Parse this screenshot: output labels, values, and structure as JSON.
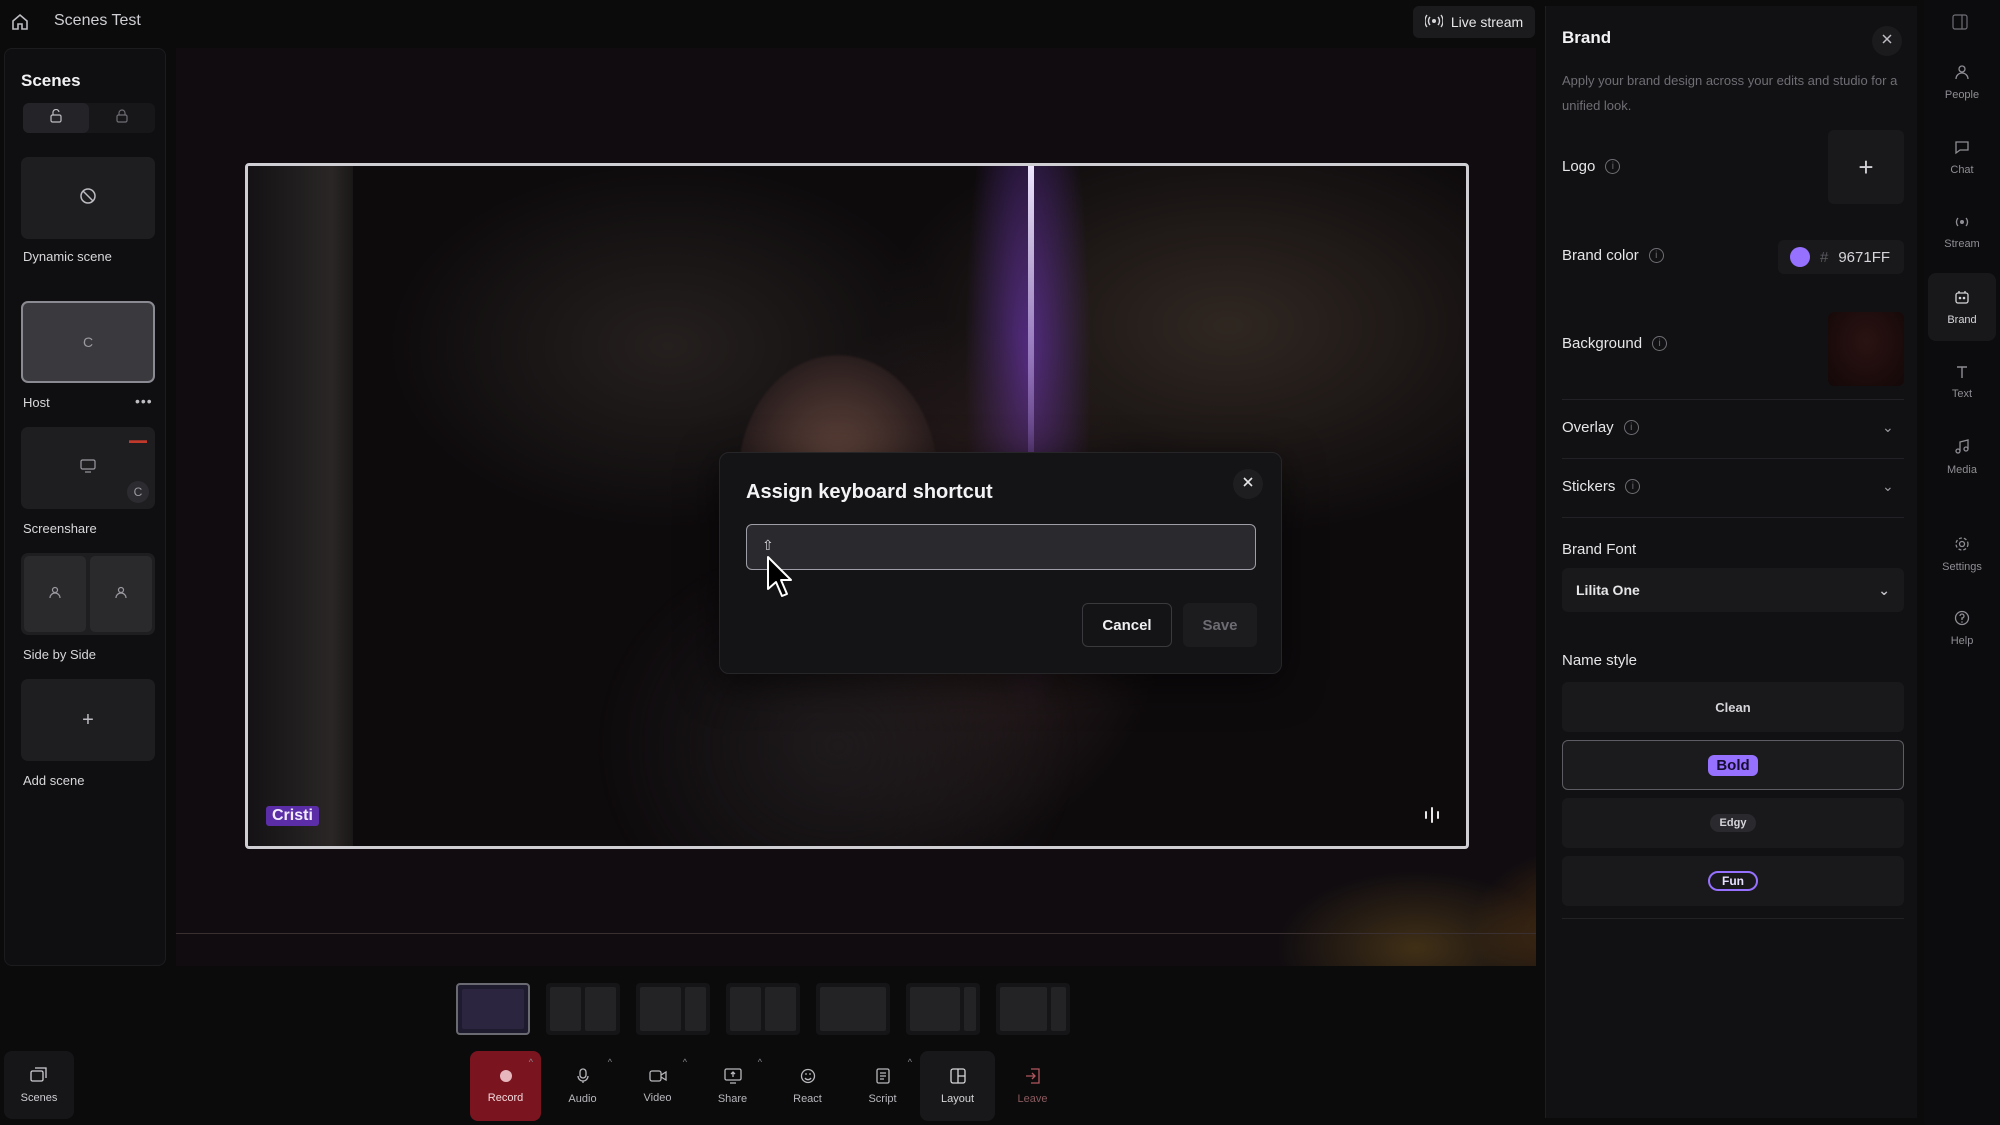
{
  "app": {
    "title": "Scenes Test",
    "live_stream_label": "Live stream"
  },
  "scenes": {
    "title": "Scenes",
    "items": [
      {
        "label": "Dynamic scene"
      },
      {
        "label": "Host",
        "thumb_text": "C"
      },
      {
        "label": "Screenshare",
        "badge": "C"
      },
      {
        "label": "Side by Side"
      },
      {
        "label": "Add scene"
      }
    ]
  },
  "stage": {
    "name_tag": "Cristi"
  },
  "modal": {
    "title": "Assign keyboard shortcut",
    "input_value": "",
    "shift_glyph": "⇧",
    "cancel_label": "Cancel",
    "save_label": "Save"
  },
  "toolbar": {
    "scenes_label": "Scenes",
    "items": [
      {
        "label": "Record"
      },
      {
        "label": "Audio"
      },
      {
        "label": "Video"
      },
      {
        "label": "Share"
      },
      {
        "label": "React"
      },
      {
        "label": "Script"
      },
      {
        "label": "Layout"
      },
      {
        "label": "Leave"
      }
    ]
  },
  "brand": {
    "title": "Brand",
    "description": "Apply your brand design across your edits and studio for a unified look.",
    "logo_label": "Logo",
    "brand_color_label": "Brand color",
    "brand_color_hex": "9671FF",
    "brand_color": "#9671FF",
    "background_label": "Background",
    "overlay_label": "Overlay",
    "stickers_label": "Stickers",
    "brand_font_label": "Brand Font",
    "brand_font_value": "Lilita One",
    "name_style_label": "Name style",
    "name_styles": [
      "Clean",
      "Bold",
      "Edgy",
      "Fun"
    ],
    "selected_name_style": "Bold"
  },
  "rail": {
    "items": [
      {
        "label": "People",
        "icon": "people-icon"
      },
      {
        "label": "Chat",
        "icon": "chat-icon"
      },
      {
        "label": "Stream",
        "icon": "stream-icon"
      },
      {
        "label": "Brand",
        "icon": "brand-icon"
      },
      {
        "label": "Text",
        "icon": "text-icon"
      },
      {
        "label": "Media",
        "icon": "media-icon"
      },
      {
        "label": "Settings",
        "icon": "settings-icon"
      },
      {
        "label": "Help",
        "icon": "help-icon"
      }
    ]
  }
}
